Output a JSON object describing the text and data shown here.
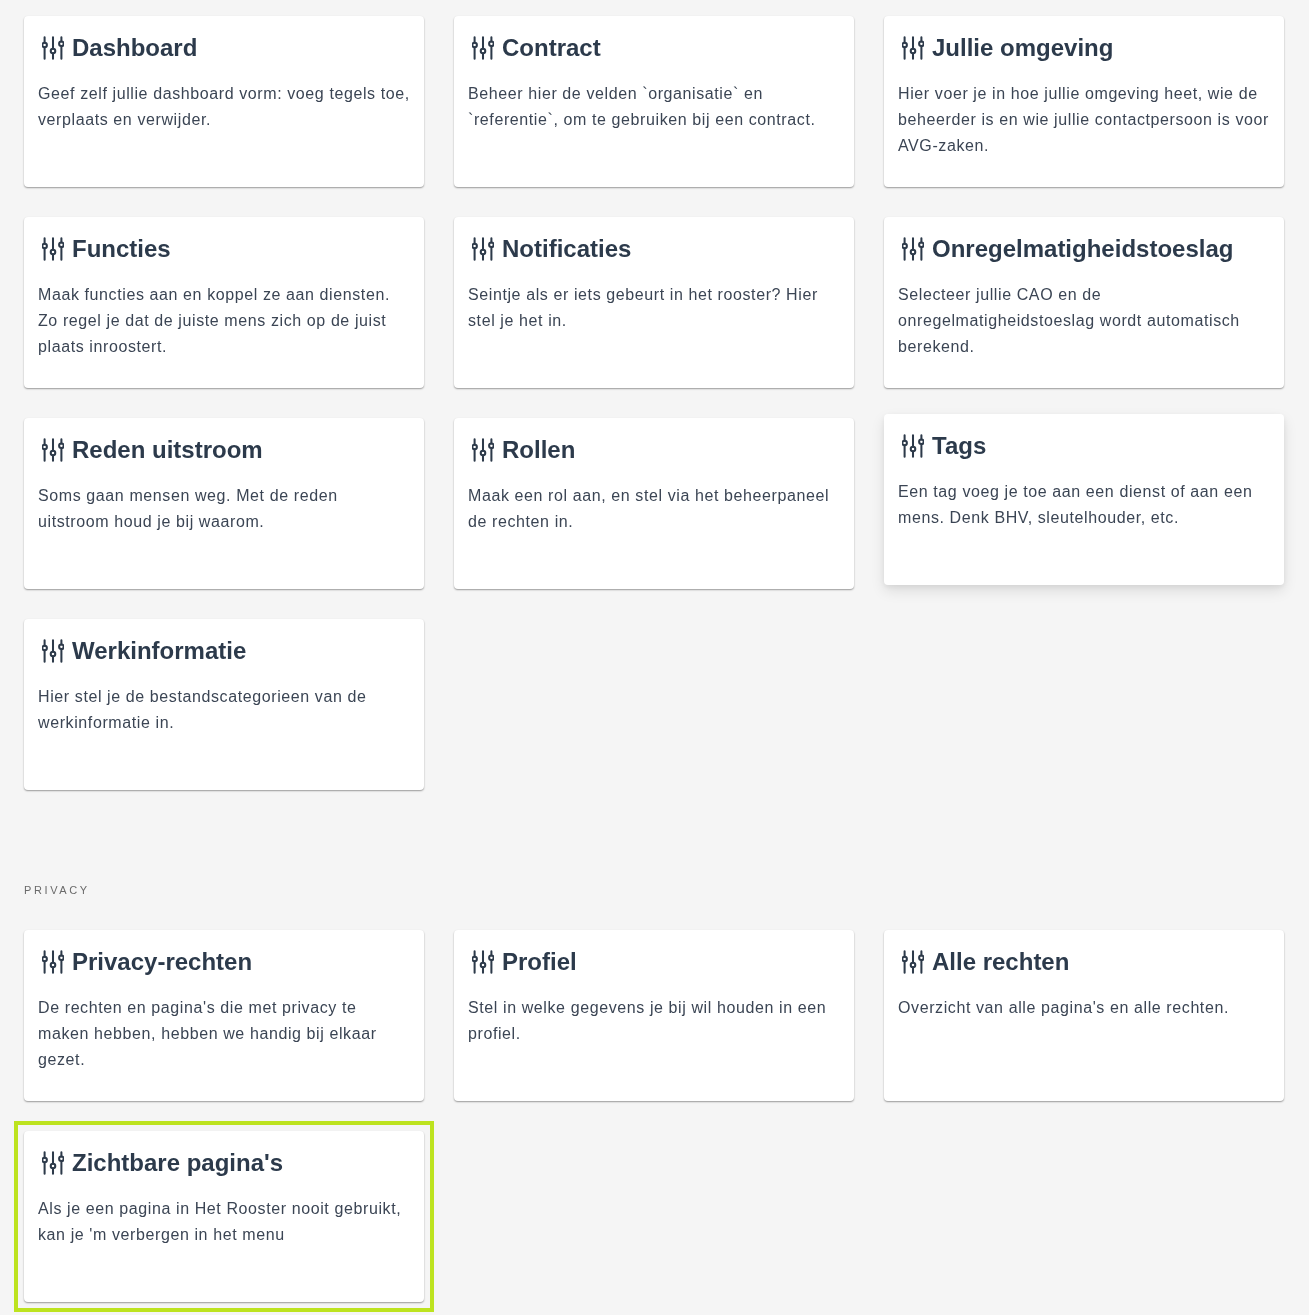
{
  "sections": [
    {
      "cards": [
        {
          "title": "Dashboard",
          "description": "Geef zelf jullie dashboard vorm: voeg tegels toe, verplaats en verwijder.",
          "hovered": false,
          "focused": false
        },
        {
          "title": "Contract",
          "description": "Beheer hier de velden `organisatie` en `referentie`, om te gebruiken bij een contract.",
          "hovered": false,
          "focused": false
        },
        {
          "title": "Jullie omgeving",
          "description": "Hier voer je in hoe jullie omgeving heet, wie de beheerder is en wie jullie contactpersoon is voor AVG-zaken.",
          "hovered": false,
          "focused": false
        },
        {
          "title": "Functies",
          "description": "Maak functies aan en koppel ze aan diensten. Zo regel je dat de juiste mens zich op de juist plaats inroostert.",
          "hovered": false,
          "focused": false
        },
        {
          "title": "Notificaties",
          "description": "Seintje als er iets gebeurt in het rooster? Hier stel je het in.",
          "hovered": false,
          "focused": false
        },
        {
          "title": "Onregelmatigheidstoeslag",
          "description": "Selecteer jullie CAO en de onregelmatigheidstoeslag wordt automatisch berekend.",
          "hovered": false,
          "focused": false
        },
        {
          "title": "Reden uitstroom",
          "description": "Soms gaan mensen weg. Met de reden uitstroom houd je bij waarom.",
          "hovered": false,
          "focused": false
        },
        {
          "title": "Rollen",
          "description": "Maak een rol aan, en stel via het beheerpaneel de rechten in.",
          "hovered": false,
          "focused": false
        },
        {
          "title": "Tags",
          "description": "Een tag voeg je toe aan een dienst of aan een mens. Denk BHV, sleutelhouder, etc.",
          "hovered": true,
          "focused": false
        },
        {
          "title": "Werkinformatie",
          "description": "Hier stel je de bestandscategorieen van de werkinformatie in.",
          "hovered": false,
          "focused": false
        }
      ]
    },
    {
      "heading": "PRIVACY",
      "cards": [
        {
          "title": "Privacy-rechten",
          "description": "De rechten en pagina's die met privacy te maken hebben, hebben we handig bij elkaar gezet.",
          "hovered": false,
          "focused": false
        },
        {
          "title": "Profiel",
          "description": "Stel in welke gegevens je bij wil houden in een profiel.",
          "hovered": false,
          "focused": false
        },
        {
          "title": "Alle rechten",
          "description": "Overzicht van alle pagina's en alle rechten.",
          "hovered": false,
          "focused": false
        },
        {
          "title": "Zichtbare pagina's",
          "description": "Als je een pagina in Het Rooster nooit gebruikt, kan je 'm verbergen in het menu",
          "hovered": false,
          "focused": true
        }
      ]
    }
  ]
}
